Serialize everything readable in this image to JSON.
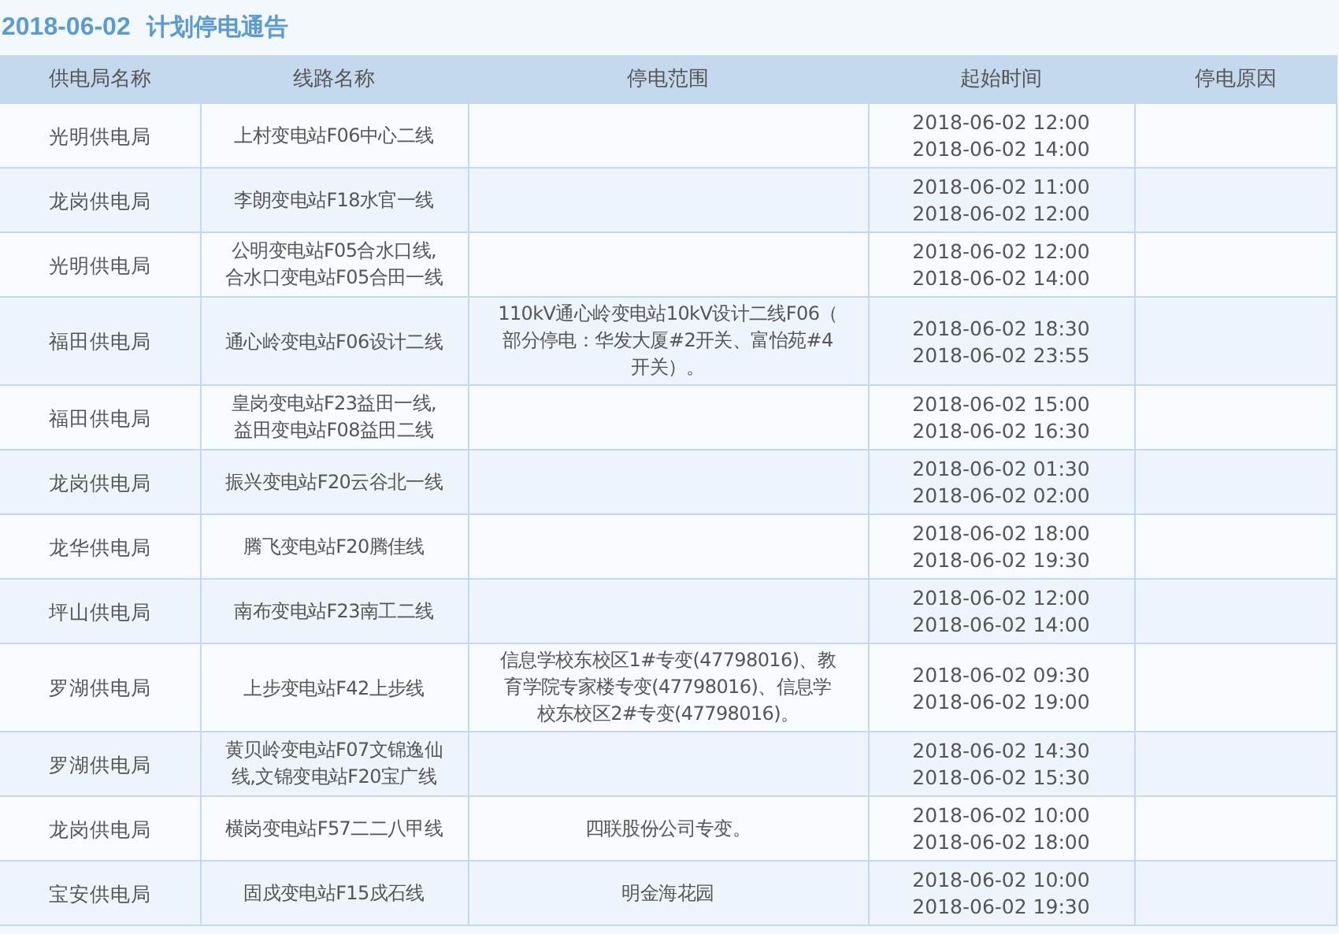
{
  "title": {
    "date": "2018-06-02",
    "text": "计划停电通告"
  },
  "table": {
    "columns": [
      "供电局名称",
      "线路名称",
      "停电范围",
      "起始时间",
      "停电原因"
    ],
    "rows": [
      {
        "bureau": "光明供电局",
        "line": [
          "上村变电站F06中心二线"
        ],
        "scope": [],
        "start": "2018-06-02 12:00",
        "end": "2018-06-02 14:00"
      },
      {
        "bureau": "龙岗供电局",
        "line": [
          "李朗变电站F18水官一线"
        ],
        "scope": [],
        "start": "2018-06-02 11:00",
        "end": "2018-06-02 12:00"
      },
      {
        "bureau": "光明供电局",
        "line": [
          "公明变电站F05合水口线,",
          "合水口变电站F05合田一线"
        ],
        "scope": [],
        "start": "2018-06-02 12:00",
        "end": "2018-06-02 14:00"
      },
      {
        "bureau": "福田供电局",
        "line": [
          "通心岭变电站F06设计二线"
        ],
        "scope": [
          "110kV通心岭变电站10kV设计二线F06（",
          "部分停电：华发大厦#2开关、富怡苑#4",
          "开关）。"
        ],
        "start": "2018-06-02 18:30",
        "end": "2018-06-02 23:55"
      },
      {
        "bureau": "福田供电局",
        "line": [
          "皇岗变电站F23益田一线,",
          "益田变电站F08益田二线"
        ],
        "scope": [],
        "start": "2018-06-02 15:00",
        "end": "2018-06-02 16:30"
      },
      {
        "bureau": "龙岗供电局",
        "line": [
          "振兴变电站F20云谷北一线"
        ],
        "scope": [],
        "start": "2018-06-02 01:30",
        "end": "2018-06-02 02:00"
      },
      {
        "bureau": "龙华供电局",
        "line": [
          "腾飞变电站F20腾佳线"
        ],
        "scope": [],
        "start": "2018-06-02 18:00",
        "end": "2018-06-02 19:30"
      },
      {
        "bureau": "坪山供电局",
        "line": [
          "南布变电站F23南工二线"
        ],
        "scope": [],
        "start": "2018-06-02 12:00",
        "end": "2018-06-02 14:00"
      },
      {
        "bureau": "罗湖供电局",
        "line": [
          "上步变电站F42上步线"
        ],
        "scope": [
          "信息学校东校区1#专变(47798016)、教",
          "育学院专家楼专变(47798016)、信息学",
          "校东校区2#专变(47798016)。"
        ],
        "start": "2018-06-02 09:30",
        "end": "2018-06-02 19:00"
      },
      {
        "bureau": "罗湖供电局",
        "line": [
          "黄贝岭变电站F07文锦逸仙",
          "线,文锦变电站F20宝广线"
        ],
        "scope": [],
        "start": "2018-06-02 14:30",
        "end": "2018-06-02 15:30"
      },
      {
        "bureau": "龙岗供电局",
        "line": [
          "横岗变电站F57二二八甲线"
        ],
        "scope": [
          "四联股份公司专变。"
        ],
        "start": "2018-06-02 10:00",
        "end": "2018-06-02 18:00"
      },
      {
        "bureau": "宝安供电局",
        "line": [
          "固戍变电站F15戍石线"
        ],
        "scope": [
          "明金海花园"
        ],
        "start": "2018-06-02 10:00",
        "end": "2018-06-02 19:30"
      }
    ]
  }
}
